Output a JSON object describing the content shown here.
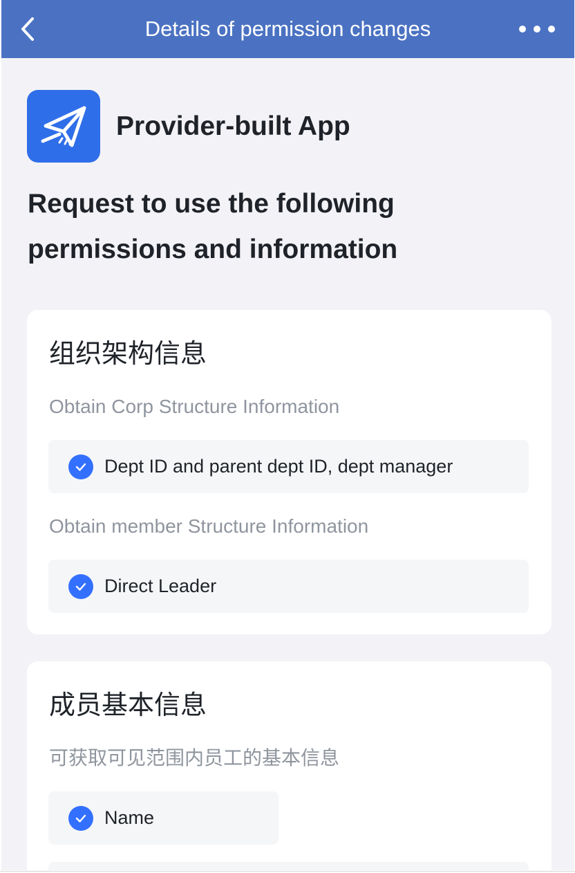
{
  "navbar": {
    "title": "Details of permission changes",
    "back_icon": "chevron-left-icon",
    "more_icon": "more-horizontal-icon",
    "background": "#4b72c2"
  },
  "app": {
    "name": "Provider-built App",
    "logo_icon": "paper-plane-logo",
    "logo_color": "#2f6ee9"
  },
  "request_heading": "Request to use the following permissions and information",
  "sections": [
    {
      "title": "组织架构信息",
      "groups": [
        {
          "label": "Obtain Corp Structure Information",
          "items": [
            "Dept ID and parent dept ID, dept manager"
          ]
        },
        {
          "label": "Obtain member Structure Information",
          "items": [
            "Direct Leader"
          ]
        }
      ]
    },
    {
      "title": "成员基本信息",
      "groups": [
        {
          "label": "可获取可见范围内员工的基本信息",
          "items": [
            "Name"
          ]
        }
      ]
    }
  ],
  "colors": {
    "check": "#3370ff",
    "page_background": "#f3f3f7",
    "muted_text": "#8f959e"
  }
}
